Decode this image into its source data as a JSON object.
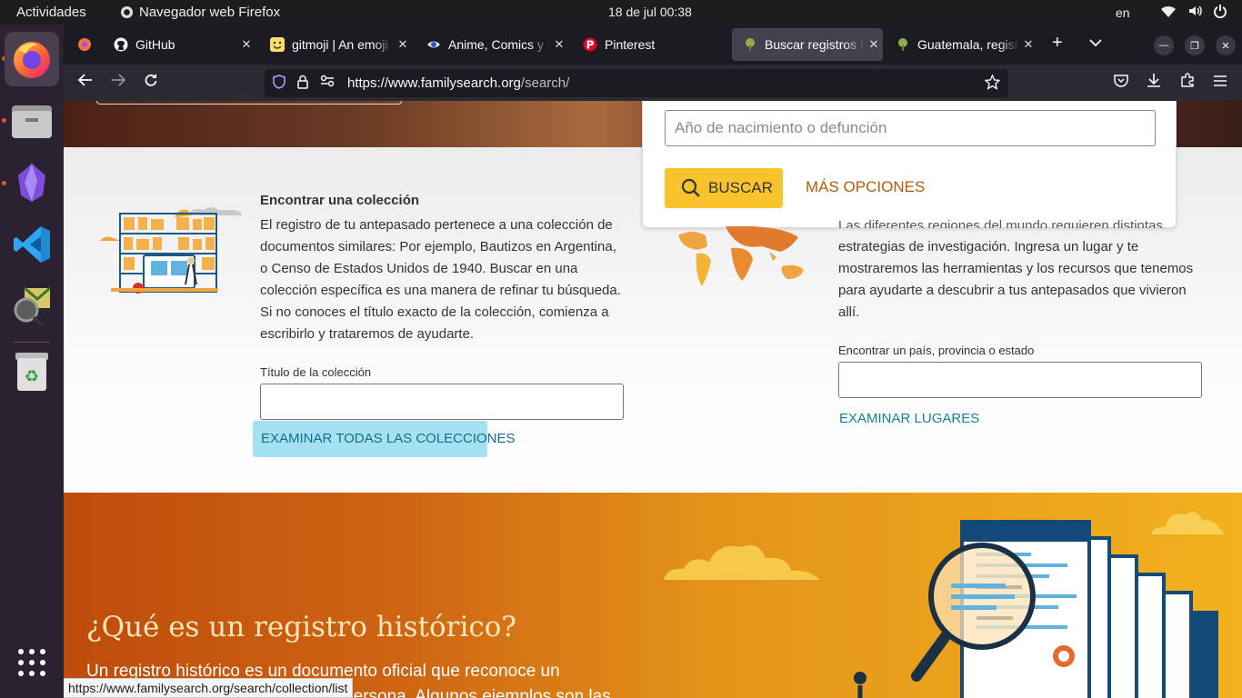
{
  "topbar": {
    "activities": "Actividades",
    "app_name": "Navegador web Firefox",
    "clock": "18 de jul  00:38",
    "lang": "en"
  },
  "dock": {
    "items": [
      "firefox-icon",
      "files-icon",
      "obsidian-icon",
      "vscode-icon",
      "photo-tool-icon",
      "trash-icon"
    ],
    "grid_icon": "app-grid-icon"
  },
  "tabs": [
    {
      "label": "",
      "icon": "firefox-icon"
    },
    {
      "label": "GitHub",
      "icon": "github-icon"
    },
    {
      "label": "gitmoji | An emoji guide",
      "icon": "gitmoji-icon"
    },
    {
      "label": "Anime, Comics y más",
      "icon": "eye-icon"
    },
    {
      "label": "Pinterest",
      "icon": "pinterest-icon"
    },
    {
      "label": "Buscar registros históricos",
      "icon": "familysearch-icon"
    },
    {
      "label": "Guatemala, registros",
      "icon": "familysearch-icon"
    }
  ],
  "url": {
    "host": "https://www.familysearch.org",
    "path": "/search/"
  },
  "search": {
    "year_placeholder": "Año de nacimiento o defunción",
    "buscar": "BUSCAR",
    "mas_opciones": "MÁS OPCIONES"
  },
  "collection": {
    "title": "Encontrar una colección",
    "text": "El registro de tu antepasado pertenece a una colección de documentos similares: Por ejemplo, Bautizos en Argentina, o Censo de Estados Unidos de 1940. Buscar en una colección específica es una manera de refinar tu búsqueda. Si no conoces el título exacto de la colección, comienza a escribirlo y trataremos de ayudarte.",
    "field_label": "Título de la colección",
    "browse": "EXAMINAR TODAS LAS COLECCIONES"
  },
  "places": {
    "text_top": "Las diferentes regiones del mundo requieren distintas",
    "text": "estrategias de investigación. Ingresa un lugar y te mostraremos las herramientas y los recursos que tenemos para ayudarte a descubrir a tus antepasados que vivieron allí.",
    "field_label": "Encontrar un país, provincia o estado",
    "browse": "EXAMINAR LUGARES"
  },
  "historic": {
    "title": "¿Qué es un registro histórico?",
    "text": "Un registro histórico es un documento oficial que reconoce un acontecimiento en la vida de una persona. Algunos ejemplos son las"
  },
  "status_url": "https://www.familysearch.org/search/collection/list",
  "colors": {
    "accent_yellow": "#f8c32d",
    "link_blue": "#1380a1",
    "orange": "#b35d0a"
  }
}
